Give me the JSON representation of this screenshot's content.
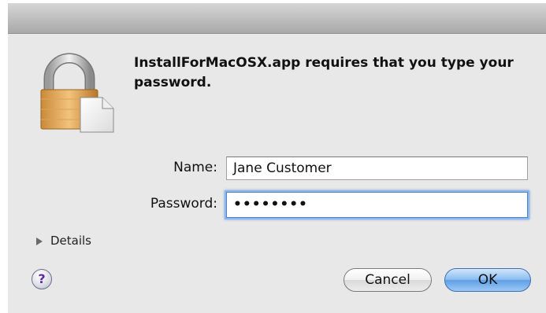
{
  "dialog": {
    "message": "InstallForMacOSX.app requires that you type your password.",
    "name_label": "Name:",
    "name_value": "Jane Customer",
    "password_label": "Password:",
    "password_value": "••••••••",
    "details_label": "Details",
    "help_label": "?",
    "cancel_label": "Cancel",
    "ok_label": "OK"
  },
  "icons": {
    "lock": "lock-document-icon",
    "disclosure": "disclosure-triangle-icon"
  },
  "colors": {
    "accent": "#5f9ee6",
    "focus_ring": "#8fb6ea",
    "window_bg": "#e8e8e8"
  }
}
